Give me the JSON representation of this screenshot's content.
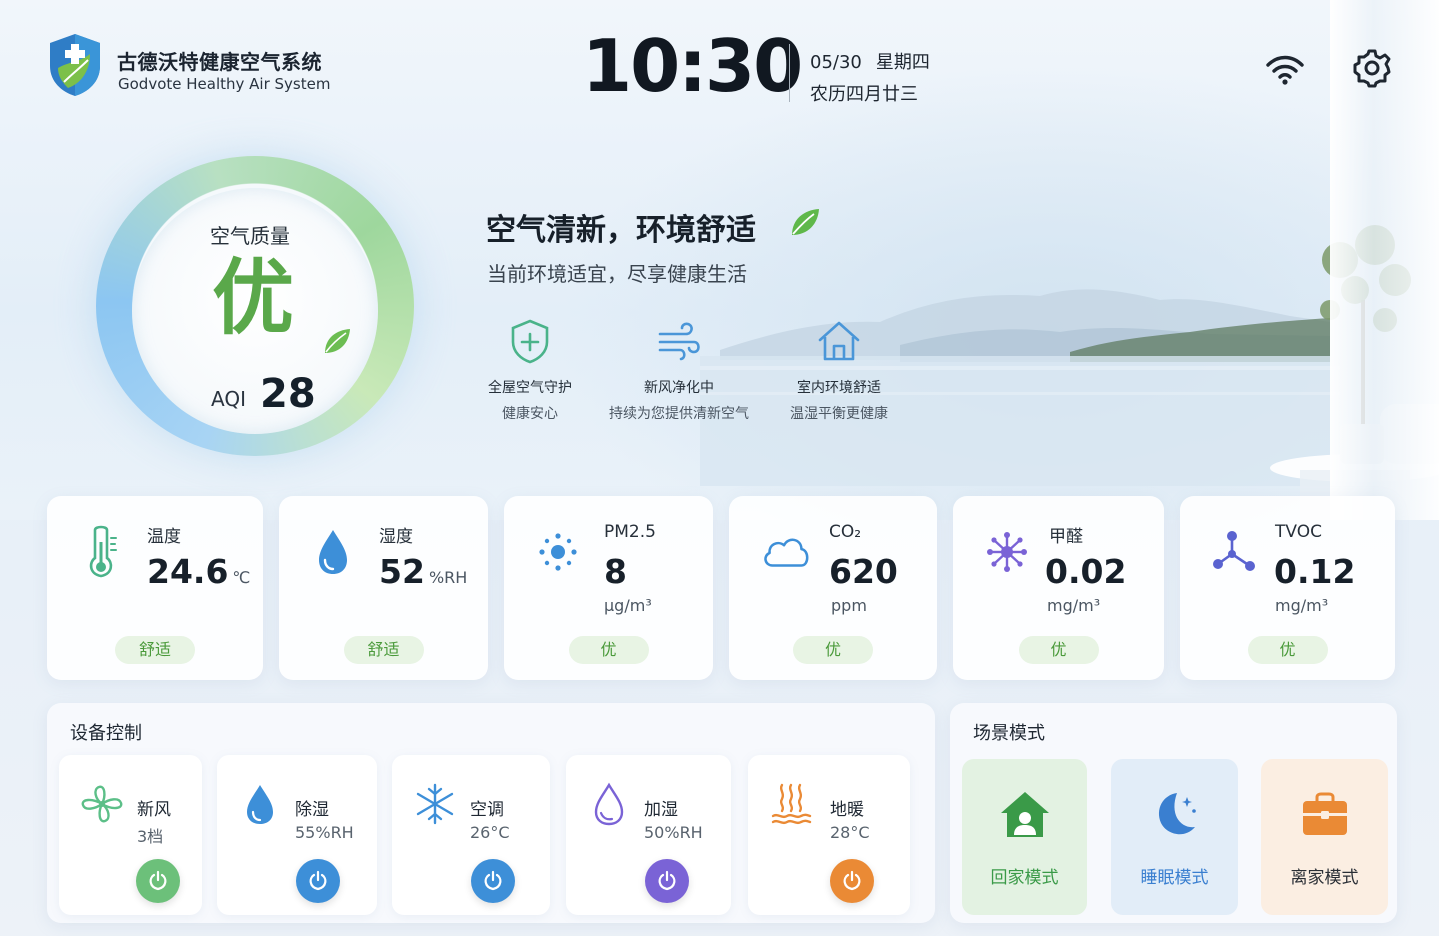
{
  "header": {
    "brand_cn": "古德沃特健康空气系统",
    "brand_en": "Godvote Healthy Air System",
    "time": "10:30",
    "date": "05/30",
    "weekday": "星期四",
    "lunar": "农历四月廿三",
    "icons": [
      "shield-logo-icon",
      "wifi-icon",
      "gear-icon"
    ]
  },
  "aqi": {
    "title": "空气质量",
    "level": "优",
    "label": "AQI",
    "value": "28",
    "color": "#5aa84a"
  },
  "hero": {
    "headline": "空气清新，环境舒适",
    "subline": "当前环境适宜，尽享健康生活",
    "features": [
      {
        "title": "全屋空气守护",
        "sub": "健康安心",
        "icon": "shield-plus-icon"
      },
      {
        "title": "新风净化中",
        "sub": "持续为您提供清新空气",
        "icon": "wind-icon"
      },
      {
        "title": "室内环境舒适",
        "sub": "温湿平衡更健康",
        "icon": "home-icon"
      }
    ]
  },
  "sensors": [
    {
      "label": "温度",
      "value": "24.6",
      "unit": "℃",
      "status": "舒适",
      "icon": "thermometer-icon"
    },
    {
      "label": "湿度",
      "value": "52",
      "unit": "%RH",
      "status": "舒适",
      "icon": "water-drop-icon"
    },
    {
      "label": "PM2.5",
      "value": "8",
      "unit": "μg/m³",
      "status": "优",
      "icon": "particles-icon"
    },
    {
      "label": "CO₂",
      "value": "620",
      "unit": "ppm",
      "status": "优",
      "icon": "cloud-icon"
    },
    {
      "label": "甲醛",
      "value": "0.02",
      "unit": "mg/m³",
      "status": "优",
      "icon": "molecule-icon"
    },
    {
      "label": "TVOC",
      "value": "0.12",
      "unit": "mg/m³",
      "status": "优",
      "icon": "network-icon"
    }
  ],
  "devices": {
    "title": "设备控制",
    "items": [
      {
        "name": "新风",
        "value": "3档",
        "color": "#6cc07a",
        "icon": "fan-icon"
      },
      {
        "name": "除湿",
        "value": "55%RH",
        "color": "#3d8fd8",
        "icon": "water-drop-icon"
      },
      {
        "name": "空调",
        "value": "26°C",
        "color": "#3d8fd8",
        "icon": "snowflake-icon"
      },
      {
        "name": "加湿",
        "value": "50%RH",
        "color": "#7a63d6",
        "icon": "drop-outline-icon"
      },
      {
        "name": "地暖",
        "value": "28°C",
        "color": "#ea8a35",
        "icon": "heat-waves-icon"
      }
    ]
  },
  "scenes": {
    "title": "场景模式",
    "items": [
      {
        "name": "回家模式",
        "color": "#3a9a48",
        "bg": "#e3f2e2",
        "icon": "home-person-icon"
      },
      {
        "name": "睡眠模式",
        "color": "#3a7fd0",
        "bg": "#e2edf8",
        "icon": "moon-icon"
      },
      {
        "name": "离家模式",
        "color": "#2a2f36",
        "bg": "#fbeee2",
        "icon": "briefcase-icon"
      }
    ]
  }
}
